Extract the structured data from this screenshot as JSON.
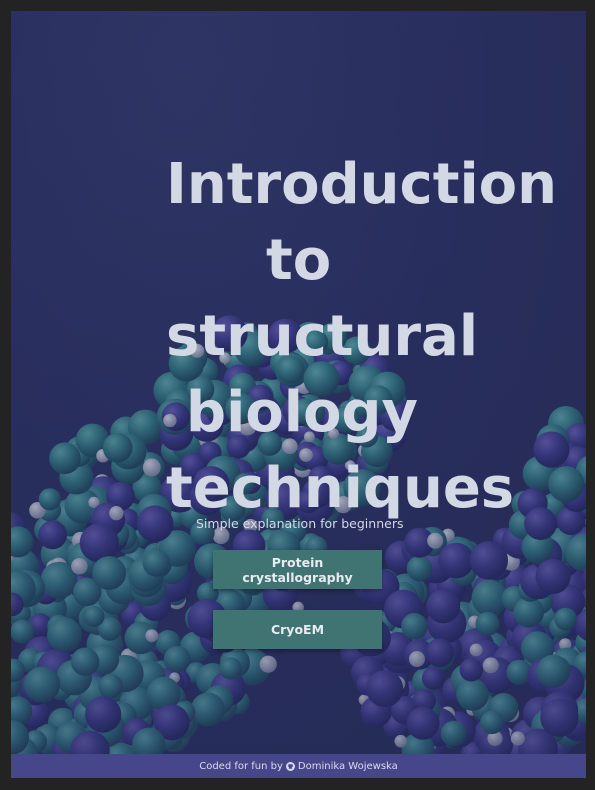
{
  "hero": {
    "title_lines": [
      "Introduction",
      "to",
      "structural",
      "biology",
      "techniques"
    ],
    "subtitle": "Simple explanation for beginners"
  },
  "buttons": {
    "crystallography_label": "Protein crystallography",
    "cryoem_label": "CryoEM"
  },
  "footer": {
    "prefix": "Coded for fun by",
    "icon": "github-icon",
    "author": "Dominika Wojewska"
  },
  "colors": {
    "background": "#2a3060",
    "title_text": "#d3d8e5",
    "button": "#3f7472",
    "footer": "#46468a"
  }
}
